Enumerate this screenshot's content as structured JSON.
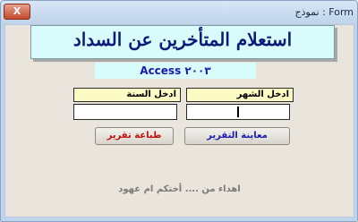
{
  "window": {
    "title": "Form : نموذج",
    "close_label": "X"
  },
  "banner": {
    "title": "استعلام المتأخرين عن السداد",
    "subtitle": "Access ٢٠٠٣"
  },
  "fields": {
    "month_label": "ادخل الشهر",
    "year_label": "ادخل السنة",
    "month_value": "",
    "year_value": ""
  },
  "buttons": {
    "preview": "معاينة التقرير",
    "print": "طباعة تقرير"
  },
  "colors": {
    "preview_text": "#1a1ab0",
    "print_text": "#c01010"
  },
  "footer": "اهداء من .... أختكم ام عهود"
}
